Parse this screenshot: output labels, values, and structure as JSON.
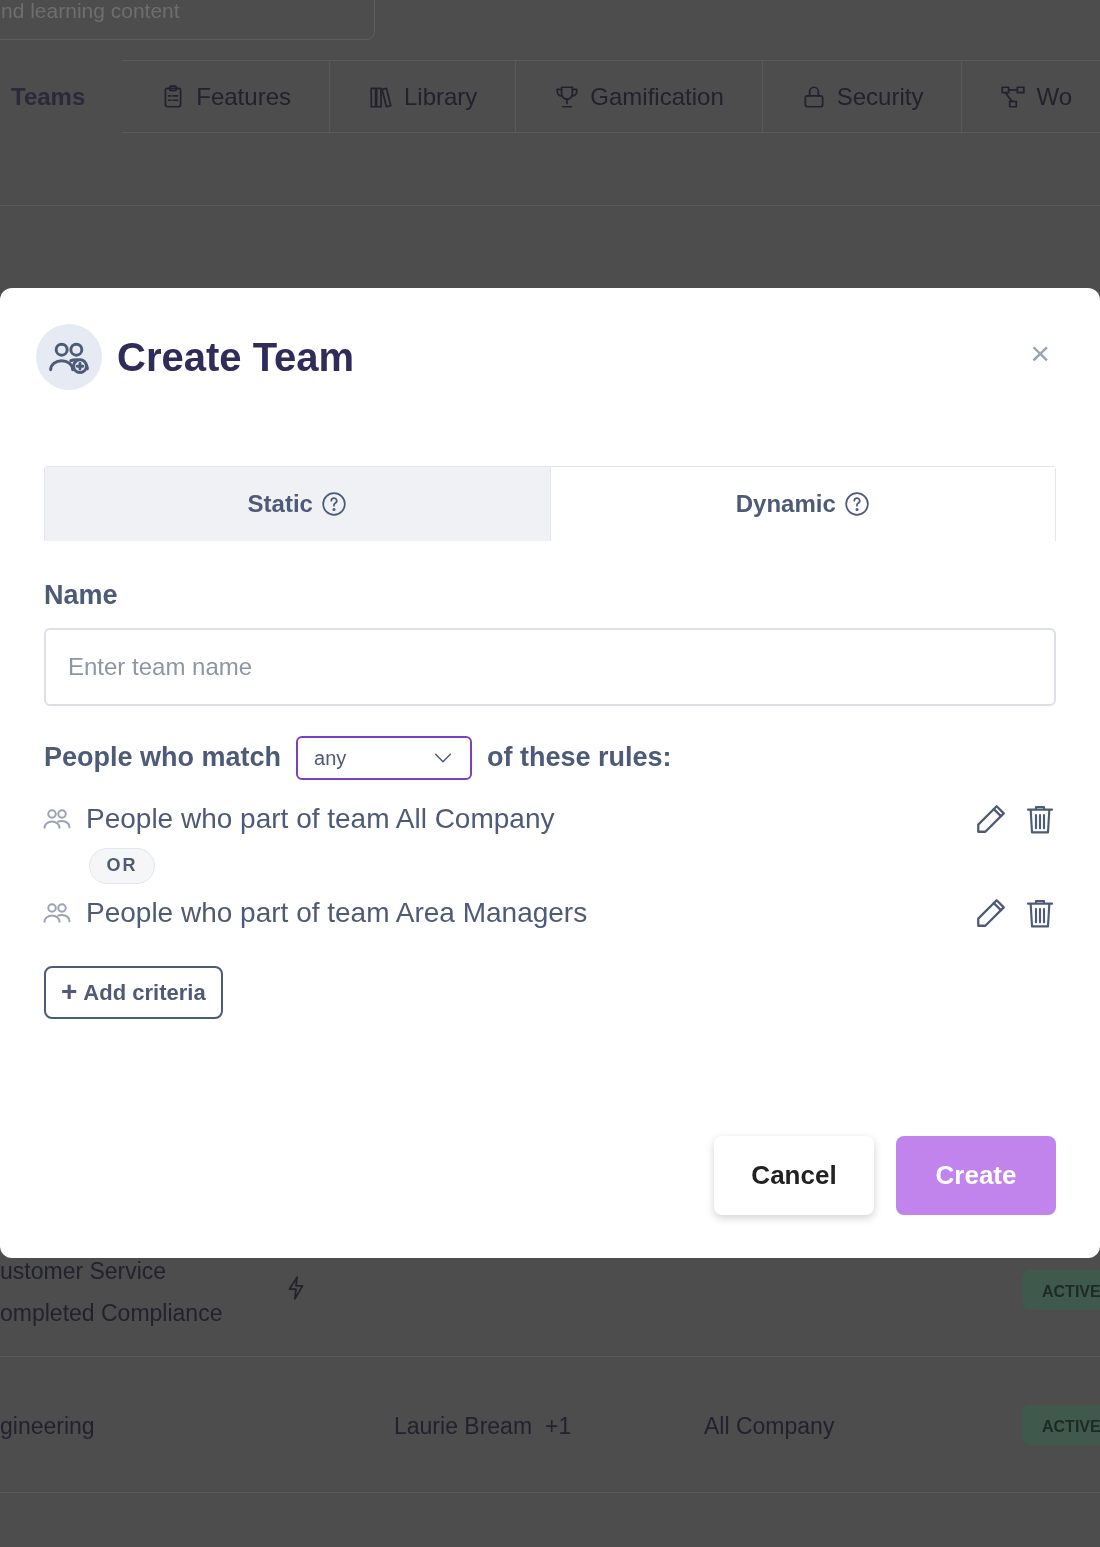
{
  "background": {
    "search": {
      "placeholder": "nd learning content"
    },
    "tabs": [
      {
        "label": "Teams",
        "selected": true
      },
      {
        "label": "Features",
        "selected": false
      },
      {
        "label": "Library",
        "selected": false
      },
      {
        "label": "Gamification",
        "selected": false
      },
      {
        "label": "Security",
        "selected": false
      },
      {
        "label": "Wo",
        "selected": false
      }
    ],
    "rows": [
      {
        "name_lines": [
          "ustomer Service",
          "ompleted Compliance"
        ],
        "dynamic": true,
        "status": "ACTIVE"
      },
      {
        "name_lines": [
          "gineering"
        ],
        "dynamic": false,
        "owner": "Laurie Bream",
        "owner_extra": "+1",
        "parent": "All Company",
        "status": "ACTIVE"
      }
    ]
  },
  "modal": {
    "title": "Create Team",
    "type_tabs": [
      {
        "label": "Static",
        "selected": false
      },
      {
        "label": "Dynamic",
        "selected": true
      }
    ],
    "name_label": "Name",
    "name_field": {
      "placeholder": "Enter team name"
    },
    "match": {
      "prefix": "People who match",
      "value": "any",
      "suffix": "of these rules:"
    },
    "rules": [
      {
        "text": "People who part of team All Company"
      },
      {
        "text": "People who part of team Area Managers"
      }
    ],
    "close_icon": "×",
    "connector": "OR",
    "add_button": {
      "icon": "+",
      "label": "Add criteria"
    },
    "buttons": [
      {
        "label": "Cancel",
        "kind": "secondary"
      },
      {
        "label": "Create",
        "kind": "primary"
      }
    ]
  }
}
